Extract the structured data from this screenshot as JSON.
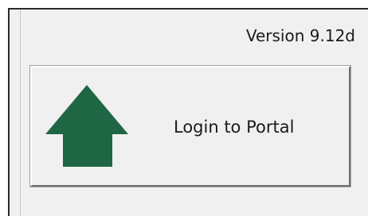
{
  "header": {
    "version_text": "Version 9.12d"
  },
  "login": {
    "button_label": "Login to Portal",
    "icon": "home-arrow-icon",
    "icon_color": "#1f6644"
  }
}
